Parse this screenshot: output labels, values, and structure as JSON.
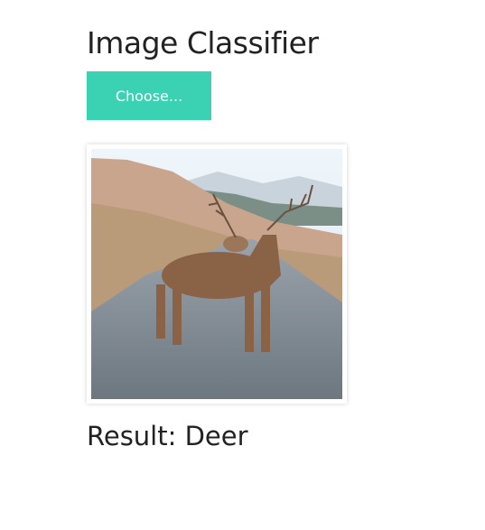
{
  "header": {
    "title": "Image Classifier"
  },
  "upload": {
    "button_label": "Choose..."
  },
  "preview": {
    "subject": "deer-photo"
  },
  "result": {
    "prefix": "Result: ",
    "label": "Deer",
    "text": "Result: Deer"
  },
  "colors": {
    "accent": "#3bd1b3"
  }
}
